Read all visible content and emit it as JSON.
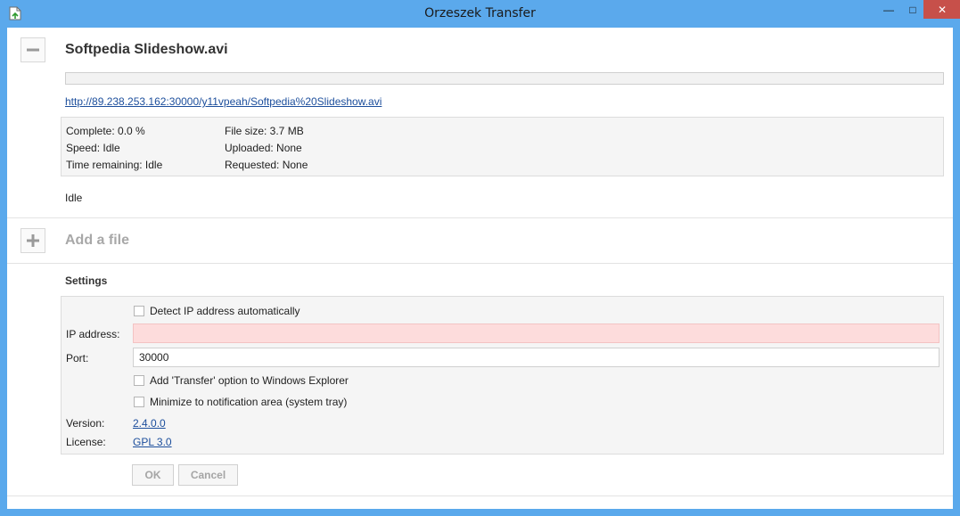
{
  "window": {
    "title": "Orzeszek Transfer",
    "controls": {
      "minimize": "—",
      "maximize": "□",
      "close": "✕"
    }
  },
  "transfer": {
    "file_name": "Softpedia Slideshow.avi",
    "progress": 0.0,
    "url": "http://89.238.253.162:30000/y11vpeah/Softpedia%20Slideshow.avi",
    "complete": "Complete: 0.0 %",
    "speed": "Speed: Idle",
    "time_remaining": "Time remaining: Idle",
    "file_size": "File size: 3.7 MB",
    "uploaded": "Uploaded: None",
    "requested": "Requested: None",
    "status": "Idle",
    "collapse_icon": "minus-icon"
  },
  "add_file": {
    "label": "Add a file",
    "icon": "plus-icon"
  },
  "settings": {
    "heading": "Settings",
    "detect_ip_label": "Detect IP address automatically",
    "detect_ip_checked": false,
    "ip_label": "IP address:",
    "ip_value": "",
    "port_label": "Port:",
    "port_value": "30000",
    "explorer_label": "Add 'Transfer' option to Windows Explorer",
    "explorer_checked": false,
    "tray_label": "Minimize to notification area (system tray)",
    "tray_checked": false,
    "version_label": "Version:",
    "version_value": "2.4.0.0",
    "license_label": "License:",
    "license_value": "GPL 3.0",
    "ok_label": "OK",
    "cancel_label": "Cancel"
  },
  "colors": {
    "titlebar": "#5ba9ec",
    "close_button": "#c7504a",
    "link": "#1c4e9c",
    "error_field": "#fddcdc"
  }
}
